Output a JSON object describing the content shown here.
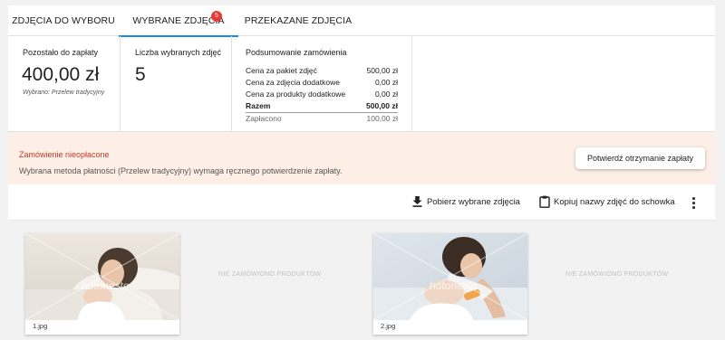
{
  "tabs": [
    {
      "label": "ZDJĘCIA DO WYBORU"
    },
    {
      "label": "WYBRANE ZDJĘCIA",
      "badge": "5",
      "active": true
    },
    {
      "label": "PRZEKAZANE ZDJĘCIA"
    }
  ],
  "stats": {
    "remaining": {
      "label": "Pozostało do zapłaty",
      "value": "400,00 zł",
      "note": "Wybrano: Przelew tradycyjny"
    },
    "selected": {
      "label": "Liczba wybranych zdjęć",
      "value": "5"
    },
    "summary": {
      "title": "Podsumowanie zamówienia",
      "rows": [
        {
          "label": "Cena za pakiet zdjęć",
          "value": "500,00 zł"
        },
        {
          "label": "Cena za zdjęcia dodatkowe",
          "value": "0,00 zł"
        },
        {
          "label": "Cena za produkty dodatkowe",
          "value": "0,00 zł"
        },
        {
          "label": "Razem",
          "value": "500,00 zł"
        },
        {
          "label": "Zapłacono",
          "value": "100,00 zł"
        }
      ]
    }
  },
  "alert": {
    "title": "Zamówienie nieopłacone",
    "text": "Wybrana metoda płatności (Przelew tradycyjny) wymaga ręcznego potwierdzenie zapłaty.",
    "button": "Potwierdź otrzymanie zapłaty"
  },
  "toolbar": {
    "download": "Pobierz wybrane zdjęcia",
    "copy": "Kopiuj nazwy zdjęć do schowka",
    "icons": {
      "download": "download-icon",
      "copy": "clipboard-icon",
      "more": "more-vert-icon"
    }
  },
  "photos": [
    {
      "filename": "1.jpg",
      "watermark": "hotonesto",
      "products": "NIE ZAMÓWIONO PRODUKTÓW"
    },
    {
      "filename": "2.jpg",
      "watermark": "hotonesto",
      "products": "NIE ZAMÓWIONO PRODUKTÓW"
    }
  ],
  "colors": {
    "accent": "#1e88e5",
    "badge": "#e53935",
    "alert_bg": "#fdefe5",
    "alert_title": "#c0392b"
  }
}
